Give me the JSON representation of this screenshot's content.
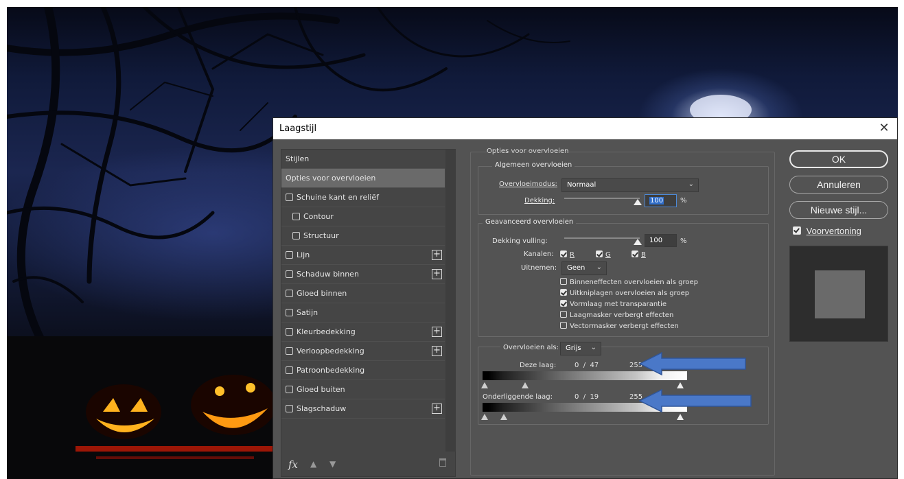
{
  "dialog": {
    "title": "Laagstijl",
    "close_icon": "close-icon"
  },
  "styles_panel": {
    "items": [
      {
        "label": "Stijlen",
        "checkbox": false,
        "plus": false,
        "selected": false
      },
      {
        "label": "Opties voor overvloeien",
        "checkbox": false,
        "plus": false,
        "selected": true
      },
      {
        "label": "Schuine kant en reliëf",
        "checkbox": true,
        "plus": false
      },
      {
        "label": "Contour",
        "checkbox": true,
        "plus": false,
        "indent": true
      },
      {
        "label": "Structuur",
        "checkbox": true,
        "plus": false,
        "indent": true
      },
      {
        "label": "Lijn",
        "checkbox": true,
        "plus": true
      },
      {
        "label": "Schaduw binnen",
        "checkbox": true,
        "plus": true
      },
      {
        "label": "Gloed binnen",
        "checkbox": true,
        "plus": false
      },
      {
        "label": "Satijn",
        "checkbox": true,
        "plus": false
      },
      {
        "label": "Kleurbedekking",
        "checkbox": true,
        "plus": true
      },
      {
        "label": "Verloopbedekking",
        "checkbox": true,
        "plus": true
      },
      {
        "label": "Patroonbedekking",
        "checkbox": true,
        "plus": false
      },
      {
        "label": "Gloed buiten",
        "checkbox": true,
        "plus": false
      },
      {
        "label": "Slagschaduw",
        "checkbox": true,
        "plus": true
      }
    ],
    "footer": {
      "fx_label": "fx",
      "up_icon": "arrow-up-icon",
      "down_icon": "arrow-down-icon",
      "trash_icon": "trash-icon"
    }
  },
  "blending": {
    "section_title": "Opties voor overvloeien",
    "general": {
      "title": "Algemeen overvloeien",
      "mode_label": "Overvloeimodus:",
      "mode_value": "Normaal",
      "opacity_label": "Dekking:",
      "opacity_value": "100",
      "opacity_unit": "%"
    },
    "advanced": {
      "title": "Geavanceerd overvloeien",
      "fill_label": "Dekking vulling:",
      "fill_value": "100",
      "fill_unit": "%",
      "channels_label": "Kanalen:",
      "channels": [
        "R",
        "G",
        "B"
      ],
      "knockout_label": "Uitnemen:",
      "knockout_value": "Geen",
      "options": [
        {
          "label": "Binneneffecten overvloeien als groep",
          "checked": false
        },
        {
          "label": "Uitkniplagen overvloeien als groep",
          "checked": true
        },
        {
          "label": "Vormlaag met transparantie",
          "checked": true
        },
        {
          "label": "Laagmasker verbergt effecten",
          "checked": false
        },
        {
          "label": "Vectormasker verbergt effecten",
          "checked": false
        }
      ]
    },
    "blend_if": {
      "label": "Overvloeien als:",
      "value": "Grijs",
      "this_layer_label": "Deze laag:",
      "this_layer_values": "0  /  47",
      "this_layer_max": "255",
      "underlying_label": "Onderliggende laag:",
      "underlying_values": "0  /  19",
      "underlying_max": "255"
    }
  },
  "buttons": {
    "ok": "OK",
    "cancel": "Annuleren",
    "new_style": "Nieuwe stijl...",
    "preview": "Voorvertoning"
  },
  "colors": {
    "dialog_bg": "#535353",
    "panel_bg": "#454545",
    "selected_item": "#6a6a6a",
    "arrow": "#4a78c8"
  }
}
